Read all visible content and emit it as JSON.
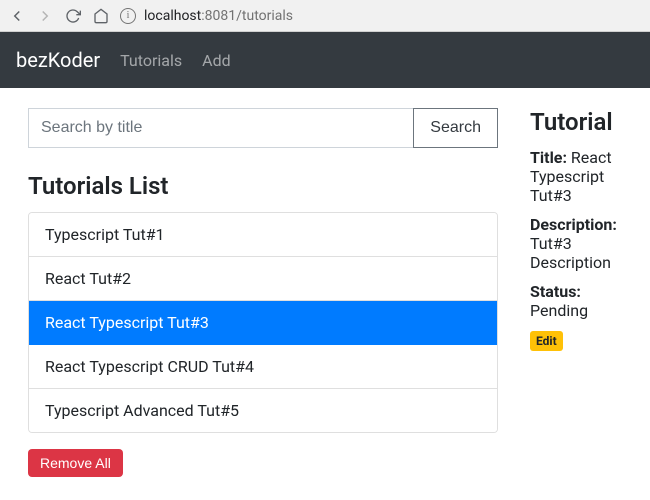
{
  "browser": {
    "url_host": "localhost",
    "url_port_path": ":8081/tutorials"
  },
  "navbar": {
    "brand": "bezKoder",
    "links": [
      "Tutorials",
      "Add"
    ]
  },
  "search": {
    "placeholder": "Search by title",
    "button": "Search"
  },
  "list": {
    "heading": "Tutorials List",
    "items": [
      "Typescript Tut#1",
      "React Tut#2",
      "React Typescript Tut#3",
      "React Typescript CRUD Tut#4",
      "Typescript Advanced Tut#5"
    ],
    "active_index": 2,
    "remove_all": "Remove All"
  },
  "detail": {
    "heading": "Tutorial",
    "title_label": "Title:",
    "title_value": "React Typescript Tut#3",
    "description_label": "Description:",
    "description_value": "Tut#3 Description",
    "status_label": "Status:",
    "status_value": "Pending",
    "edit": "Edit"
  }
}
